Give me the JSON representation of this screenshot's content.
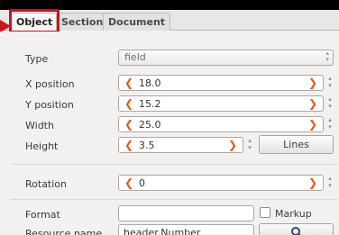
{
  "tabs": [
    "Object",
    "Section",
    "Document"
  ],
  "fields": {
    "type": {
      "label": "Type",
      "value": "field"
    },
    "x_position": {
      "label": "X position",
      "value": "18.0"
    },
    "y_position": {
      "label": "Y position",
      "value": "15.2"
    },
    "width": {
      "label": "Width",
      "value": "25.0"
    },
    "height": {
      "label": "Height",
      "value": "3.5"
    },
    "rotation": {
      "label": "Rotation",
      "value": "0"
    },
    "format": {
      "label": "Format",
      "value": ""
    },
    "resource_name": {
      "label": "Resource name",
      "value": "header.Number"
    }
  },
  "buttons": {
    "lines": "Lines"
  },
  "markup": {
    "label": "Markup",
    "checked": false
  },
  "icons": {
    "left_arrow": "chevron-left-icon",
    "right_arrow": "chevron-right-icon",
    "search": "search-icon"
  },
  "colors": {
    "highlight": "#d0101b",
    "accent_arrow": "#e05a12"
  }
}
